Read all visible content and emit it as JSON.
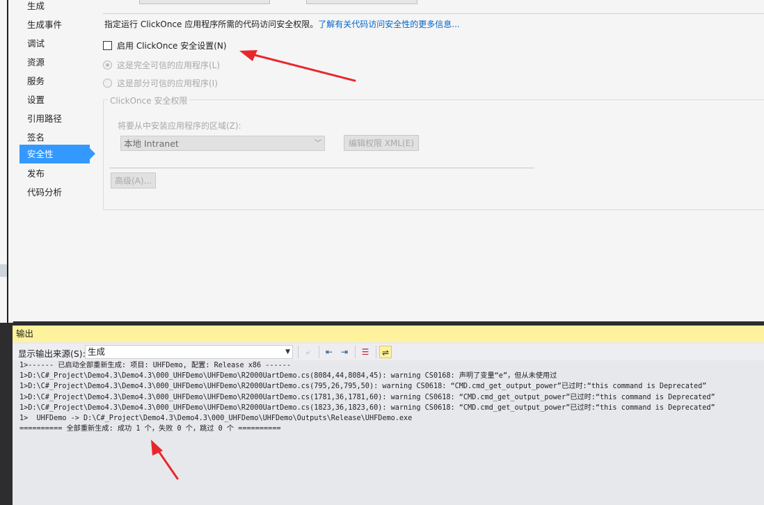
{
  "nav": {
    "items": [
      {
        "label": "生成"
      },
      {
        "label": "生成事件"
      },
      {
        "label": "调试"
      },
      {
        "label": "资源"
      },
      {
        "label": "服务"
      },
      {
        "label": "设置"
      },
      {
        "label": "引用路径"
      },
      {
        "label": "签名"
      },
      {
        "label": "安全性",
        "active": true
      },
      {
        "label": "发布"
      },
      {
        "label": "代码分析"
      }
    ]
  },
  "security": {
    "description": "指定运行 ClickOnce 应用程序所需的代码访问安全权限。",
    "link": "了解有关代码访问安全性的更多信息...",
    "enable_checkbox_label": "启用 ClickOnce 安全设置(N)",
    "enable_checked": false,
    "full_trust_label": "这是完全可信的应用程序(L)",
    "partial_trust_label": "这是部分可信的应用程序(I)",
    "group_title": "ClickOnce 安全权限",
    "zone_label": "将要从中安装应用程序的区域(Z):",
    "zone_value": "本地 Intranet",
    "edit_xml_button": "编辑权限 XML(E)",
    "advanced_button": "高级(A)..."
  },
  "output": {
    "title": "输出",
    "source_label": "显示输出来源(S):",
    "source_value": "生成",
    "lines": [
      "1>------ 已启动全部重新生成: 项目: UHFDemo, 配置: Release x86 ------",
      "1>D:\\C#_Project\\Demo4.3\\Demo4.3\\000_UHFDemo\\UHFDemo\\R2000UartDemo.cs(8084,44,8084,45): warning CS0168: 声明了变量“e”，但从未使用过",
      "1>D:\\C#_Project\\Demo4.3\\Demo4.3\\000_UHFDemo\\UHFDemo\\R2000UartDemo.cs(795,26,795,50): warning CS0618: “CMD.cmd_get_output_power”已过时:“this command is Deprecated”",
      "1>D:\\C#_Project\\Demo4.3\\Demo4.3\\000_UHFDemo\\UHFDemo\\R2000UartDemo.cs(1781,36,1781,60): warning CS0618: “CMD.cmd_get_output_power”已过时:“this command is Deprecated”",
      "1>D:\\C#_Project\\Demo4.3\\Demo4.3\\000_UHFDemo\\UHFDemo\\R2000UartDemo.cs(1823,36,1823,60): warning CS0618: “CMD.cmd_get_output_power”已过时:“this command is Deprecated”",
      "1>  UHFDemo -> D:\\C#_Project\\Demo4.3\\Demo4.3\\000_UHFDemo\\UHFDemo\\Outputs\\Release\\UHFDemo.exe",
      "========== 全部重新生成: 成功 1 个，失败 0 个，跳过 0 个 =========="
    ]
  },
  "colors": {
    "accent": "#3399ff",
    "output_title_bg": "#fff29d",
    "annotation_arrow": "#e8272c"
  },
  "icons": {
    "toolbar": [
      "go-to-prev-message-icon",
      "align-up-icon",
      "align-down-icon",
      "clear-all-icon",
      "word-wrap-icon"
    ]
  }
}
